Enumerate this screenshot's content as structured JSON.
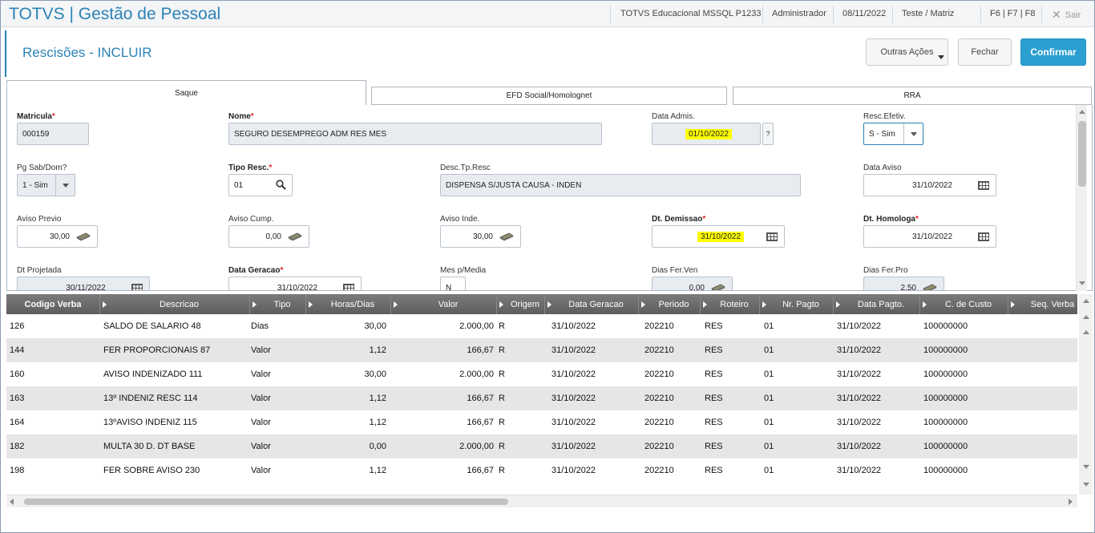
{
  "topbar": {
    "brand": "TOTVS | Gestão de Pessoal",
    "environment": "TOTVS Educacional MSSQL P1233",
    "user": "Administrador",
    "date": "08/11/2022",
    "company": "Teste / Matriz",
    "shortcuts": "F6 | F7 | F8",
    "exit_label": "Sair"
  },
  "header": {
    "title": "Rescisões - INCLUIR",
    "more_actions": "Outras Ações",
    "close": "Fechar",
    "confirm": "Confirmar"
  },
  "tabs": [
    "Saque",
    "EFD Social/Homolognet",
    "RRA"
  ],
  "form": {
    "matricula": {
      "label": "Matricula",
      "value": "000159"
    },
    "nome": {
      "label": "Nome",
      "value": "SEGURO DESEMPREGO ADM RES MES"
    },
    "data_admis": {
      "label": "Data Admis.",
      "value": "01/10/2022",
      "help": "?"
    },
    "resc_efetiv": {
      "label": "Resc.Efetiv.",
      "value": "S - Sim"
    },
    "pg_sab_dom": {
      "label": "Pg Sab/Dom?",
      "value": "1 - Sim"
    },
    "tipo_resc": {
      "label": "Tipo Resc.",
      "value": "01"
    },
    "desc_tp_resc": {
      "label": "Desc.Tp.Resc",
      "value": "DISPENSA S/JUSTA CAUSA - INDEN"
    },
    "data_aviso": {
      "label": "Data Aviso",
      "value": "31/10/2022"
    },
    "aviso_previo": {
      "label": "Aviso Previo",
      "value": "30,00"
    },
    "aviso_cump": {
      "label": "Aviso Cump.",
      "value": "0,00"
    },
    "aviso_inde": {
      "label": "Aviso Inde.",
      "value": "30,00"
    },
    "dt_demissao": {
      "label": "Dt. Demissao",
      "value": "31/10/2022"
    },
    "dt_homologa": {
      "label": "Dt. Homologa",
      "value": "31/10/2022"
    },
    "dt_projetada": {
      "label": "Dt Projetada",
      "value": "30/11/2022"
    },
    "data_geracao": {
      "label": "Data Geracao",
      "value": "31/10/2022"
    },
    "mes_p_media": {
      "label": "Mes p/Media",
      "value": "N"
    },
    "dias_fer_ven": {
      "label": "Dias Fer.Ven",
      "value": "0,00"
    },
    "dias_fer_pro": {
      "label": "Dias Fer.Pro",
      "value": "2,50"
    }
  },
  "grid": {
    "columns": [
      "Codigo Verba",
      "Descricao",
      "Tipo",
      "Horas/Dias",
      "Valor",
      "Origem",
      "Data Geracao",
      "Periodo",
      "Roteiro",
      "Nr. Pagto",
      "Data Pagto.",
      "C. de Custo",
      "Seq. Verba"
    ],
    "rows": [
      {
        "codigo": "126",
        "descricao": "SALDO DE SALARIO 48",
        "tipo": "Dias",
        "horas": "30,00",
        "valor": "2.000,00",
        "origem": "R",
        "data_geracao": "31/10/2022",
        "periodo": "202210",
        "roteiro": "RES",
        "nr_pagto": "01",
        "data_pagto": "31/10/2022",
        "custo": "100000000"
      },
      {
        "codigo": "144",
        "descricao": "FER PROPORCIONAIS 87",
        "tipo": "Valor",
        "horas": "1,12",
        "valor": "166,67",
        "origem": "R",
        "data_geracao": "31/10/2022",
        "periodo": "202210",
        "roteiro": "RES",
        "nr_pagto": "01",
        "data_pagto": "31/10/2022",
        "custo": "100000000"
      },
      {
        "codigo": "160",
        "descricao": "AVISO INDENIZADO 111",
        "tipo": "Valor",
        "horas": "30,00",
        "valor": "2.000,00",
        "origem": "R",
        "data_geracao": "31/10/2022",
        "periodo": "202210",
        "roteiro": "RES",
        "nr_pagto": "01",
        "data_pagto": "31/10/2022",
        "custo": "100000000"
      },
      {
        "codigo": "163",
        "descricao": "13º INDENIZ RESC 114",
        "tipo": "Valor",
        "horas": "1,12",
        "valor": "166,67",
        "origem": "R",
        "data_geracao": "31/10/2022",
        "periodo": "202210",
        "roteiro": "RES",
        "nr_pagto": "01",
        "data_pagto": "31/10/2022",
        "custo": "100000000"
      },
      {
        "codigo": "164",
        "descricao": "13ºAVISO INDENIZ 115",
        "tipo": "Valor",
        "horas": "1,12",
        "valor": "166,67",
        "origem": "R",
        "data_geracao": "31/10/2022",
        "periodo": "202210",
        "roteiro": "RES",
        "nr_pagto": "01",
        "data_pagto": "31/10/2022",
        "custo": "100000000"
      },
      {
        "codigo": "182",
        "descricao": "MULTA 30 D. DT BASE",
        "tipo": "Valor",
        "horas": "0,00",
        "valor": "2.000,00",
        "origem": "R",
        "data_geracao": "31/10/2022",
        "periodo": "202210",
        "roteiro": "RES",
        "nr_pagto": "01",
        "data_pagto": "31/10/2022",
        "custo": "100000000"
      },
      {
        "codigo": "198",
        "descricao": "FER SOBRE AVISO 230",
        "tipo": "Valor",
        "horas": "1,12",
        "valor": "166,67",
        "origem": "R",
        "data_geracao": "31/10/2022",
        "periodo": "202210",
        "roteiro": "RES",
        "nr_pagto": "01",
        "data_pagto": "31/10/2022",
        "custo": "100000000"
      }
    ]
  },
  "colors": {
    "accent": "#2b82b6",
    "confirm": "#2b9fd0",
    "highlight": "#ffff00",
    "required": "#e0262c",
    "grid_header": "#6b6b6b"
  }
}
